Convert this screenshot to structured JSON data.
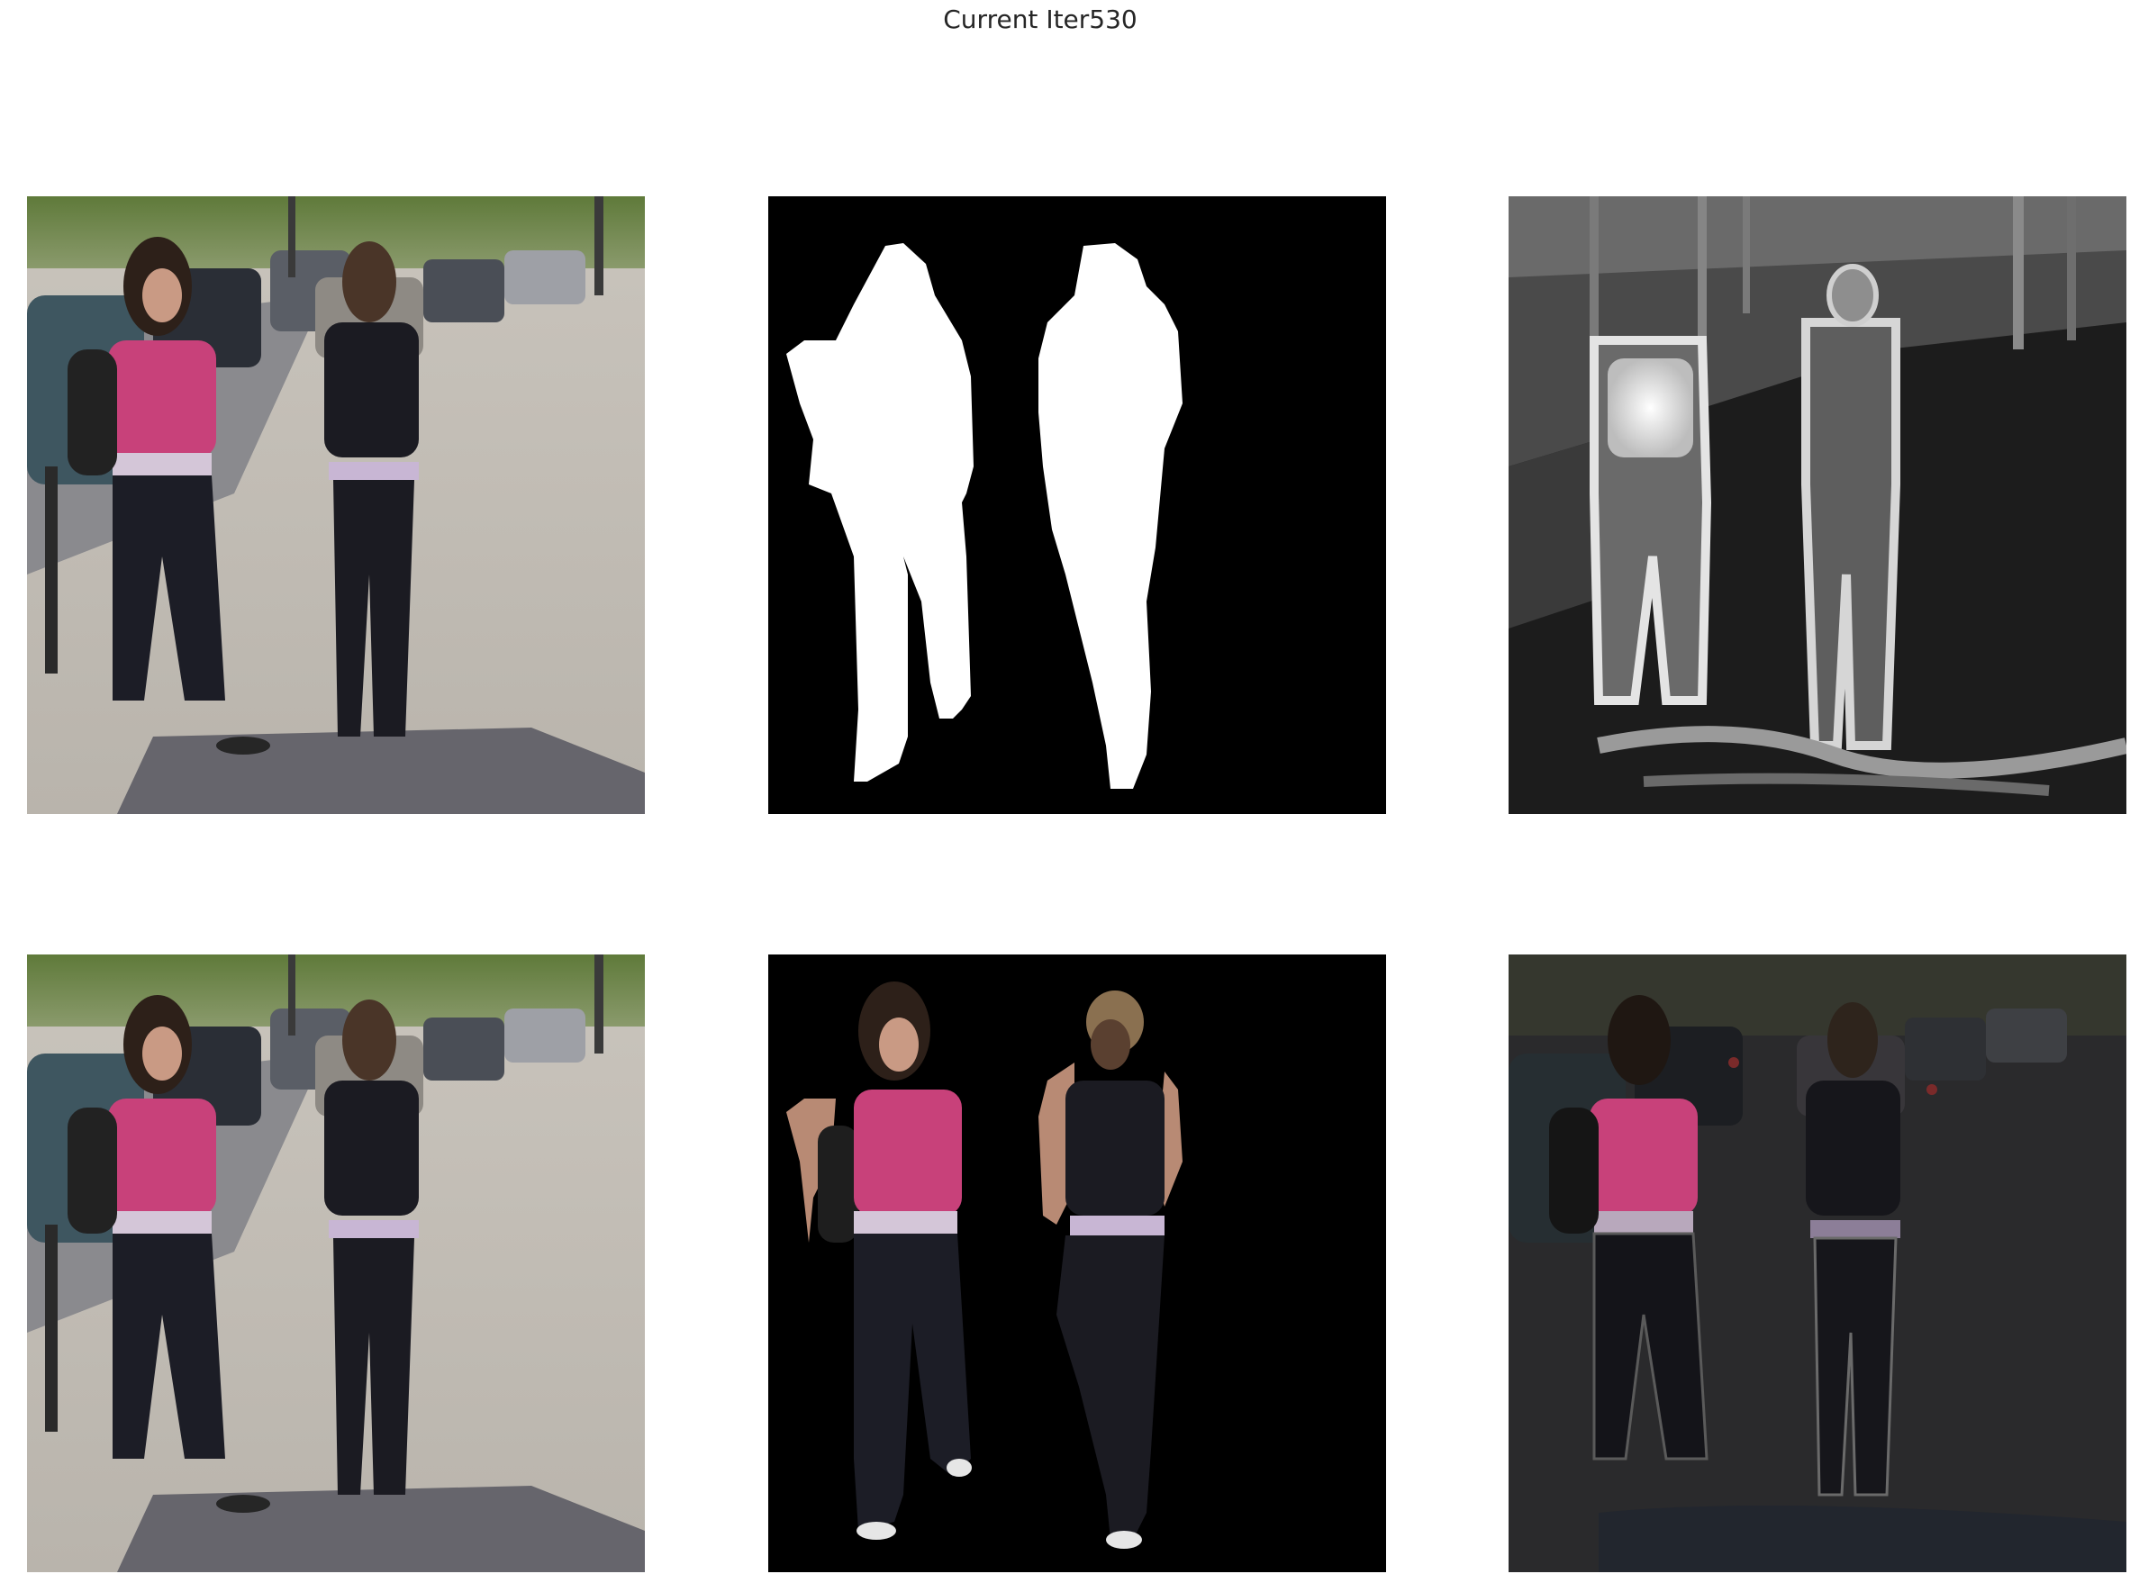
{
  "figure": {
    "suptitle": "Current Iter530"
  },
  "panels": [
    {
      "id": "original-image-top",
      "icon": "street-photo-two-women"
    },
    {
      "id": "segmentation-mask",
      "icon": "binary-mask-two-figures"
    },
    {
      "id": "attention-heatmap",
      "icon": "grayscale-edge-map"
    },
    {
      "id": "original-image-bottom",
      "icon": "street-photo-two-women"
    },
    {
      "id": "masked-cutout",
      "icon": "foreground-cutout"
    },
    {
      "id": "darkened-blend",
      "icon": "dimmed-composite"
    }
  ],
  "colors": {
    "background": "#ffffff",
    "mask_fg": "#ffffff",
    "mask_bg": "#000000",
    "pink_top": "#c8417a",
    "black_top": "#1b1b22"
  }
}
